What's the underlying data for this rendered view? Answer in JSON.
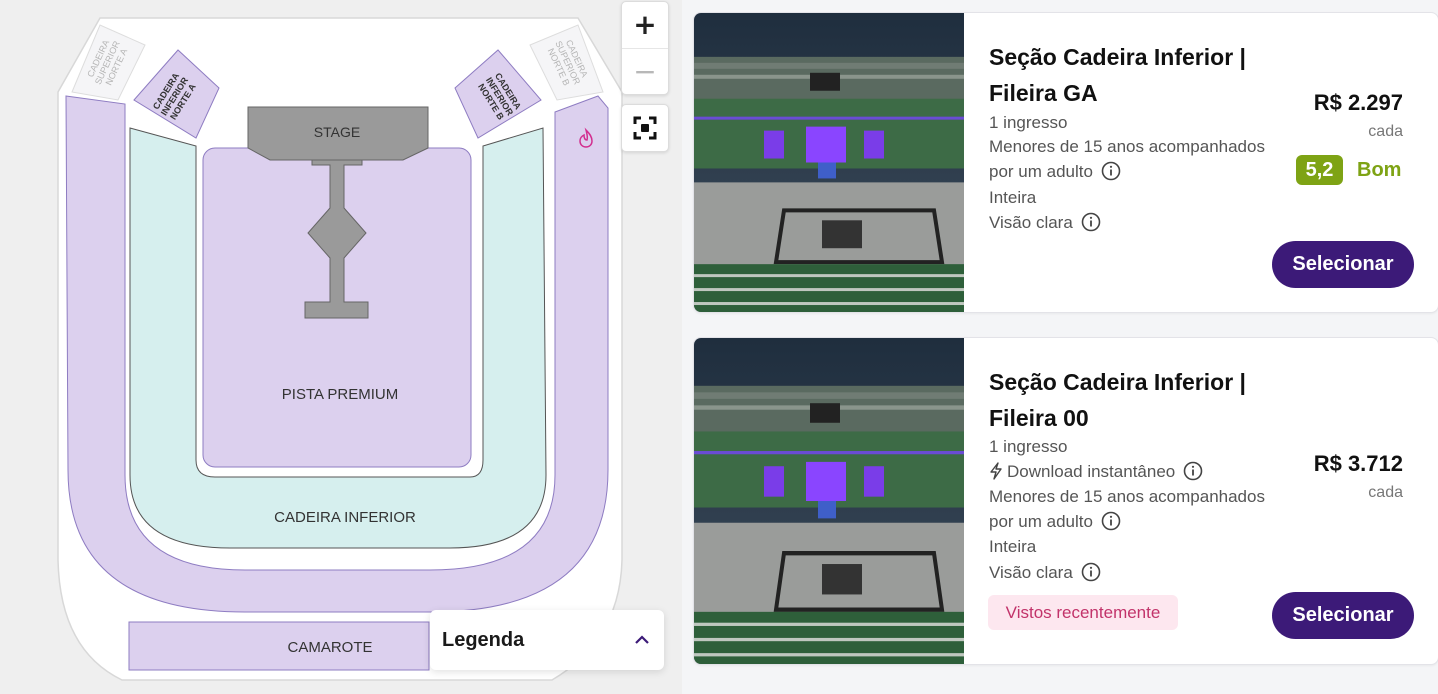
{
  "map": {
    "sections": {
      "stage": "STAGE",
      "pista_premium": "PISTA PREMIUM",
      "cadeira_inferior": "CADEIRA INFERIOR",
      "camarote": "CAMAROTE",
      "superior_norte_a": [
        "CADEIRA",
        "SUPERIOR",
        "NORTE A"
      ],
      "inferior_norte_a": [
        "CADEIRA",
        "INFERIOR",
        "NORTE A"
      ],
      "inferior_norte_b": [
        "CADEIRA",
        "INFERIOR",
        "NORTE B"
      ],
      "superior_norte_b": [
        "CADEIRA",
        "SUPERIOR",
        "NORTE B"
      ]
    },
    "zoom_in_label": "+",
    "zoom_out_label": "−",
    "legend_title": "Legenda"
  },
  "colors": {
    "section_purple": "#dcd0ee",
    "section_teal": "#d6efee",
    "stage_gray": "#9a9a9a",
    "button_purple": "#3c1a78",
    "score_green": "#7ea314",
    "recent_pink": "#c2336a"
  },
  "icons": [
    "plus-icon",
    "minus-icon",
    "fit-screen-icon",
    "fire-icon",
    "chevron-up-icon",
    "info-icon",
    "lightning-icon"
  ],
  "listings": [
    {
      "title_line1": "Seção Cadeira Inferior |",
      "title_line2": "Fileira GA",
      "quantity": "1 ingresso",
      "minors_line1": "Menores de 15 anos acompanhados",
      "minors_line2": "por um adulto",
      "ticket_type": "Inteira",
      "view": "Visão clara",
      "price": "R$ 2.297",
      "price_unit": "cada",
      "score": "5,2",
      "score_label": "Bom",
      "select_label": "Selecionar"
    },
    {
      "title_line1": "Seção Cadeira Inferior |",
      "title_line2": "Fileira 00",
      "quantity": "1 ingresso",
      "download": "Download instantâneo",
      "minors_line1": "Menores de 15 anos acompanhados",
      "minors_line2": "por um adulto",
      "ticket_type": "Inteira",
      "view": "Visão clara",
      "price": "R$ 3.712",
      "price_unit": "cada",
      "badge": "Vistos recentemente",
      "select_label": "Selecionar"
    }
  ]
}
